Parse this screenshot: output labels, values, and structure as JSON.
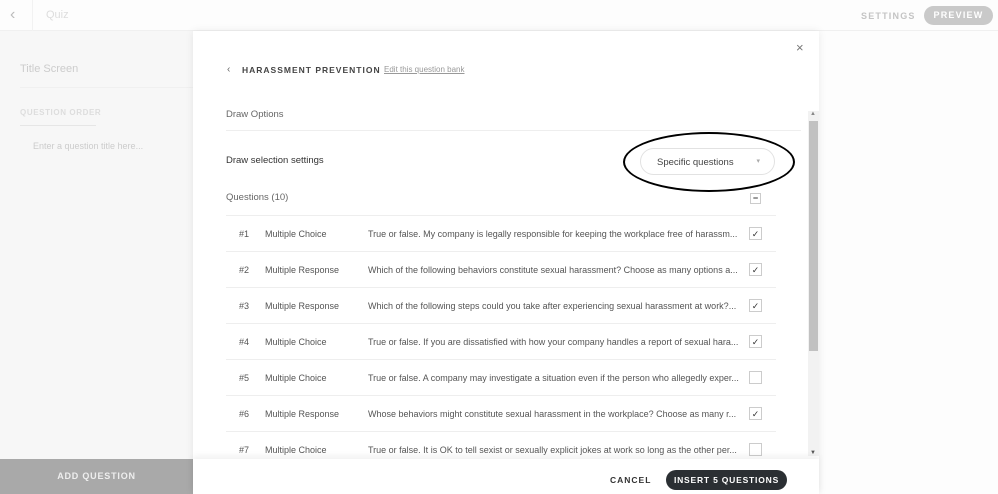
{
  "topbar": {
    "title": "Quiz",
    "settings": "SETTINGS",
    "preview": "PREVIEW",
    "back_icon": "‹"
  },
  "left": {
    "title_screen": "Title Screen",
    "question_order": "QUESTION ORDER",
    "placeholder": "Enter a question title here...",
    "add_question": "ADD QUESTION"
  },
  "modal": {
    "close": "×",
    "back": "‹",
    "title": "HARASSMENT PREVENTION",
    "edit_link": "Edit this question bank",
    "draw_options": "Draw Options",
    "draw_selection_label": "Draw selection settings",
    "draw_selection_value": "Specific questions",
    "dropdown_caret": "▾",
    "questions_header": "Questions (10)",
    "collapse": "−",
    "questions": [
      {
        "num": "#1",
        "type": "Multiple Choice",
        "text": "True or false. My company is legally responsible for keeping the workplace free of harassm...",
        "checked": true
      },
      {
        "num": "#2",
        "type": "Multiple Response",
        "text": "Which of the following behaviors constitute sexual harassment? Choose as many options a...",
        "checked": true
      },
      {
        "num": "#3",
        "type": "Multiple Response",
        "text": "Which of the following steps could you take after experiencing sexual harassment at work?...",
        "checked": true
      },
      {
        "num": "#4",
        "type": "Multiple Choice",
        "text": "True or false. If you are dissatisfied with how your company handles a report of sexual hara...",
        "checked": true
      },
      {
        "num": "#5",
        "type": "Multiple Choice",
        "text": "True or false. A company may investigate a situation even if the person who allegedly exper...",
        "checked": false
      },
      {
        "num": "#6",
        "type": "Multiple Response",
        "text": "Whose behaviors might constitute sexual harassment in the workplace? Choose as many r...",
        "checked": true
      },
      {
        "num": "#7",
        "type": "Multiple Choice",
        "text": "True or false. It is OK to tell sexist or sexually explicit jokes at work so long as the other per...",
        "checked": false
      }
    ],
    "cancel": "CANCEL",
    "insert": "INSERT 5 QUESTIONS"
  }
}
